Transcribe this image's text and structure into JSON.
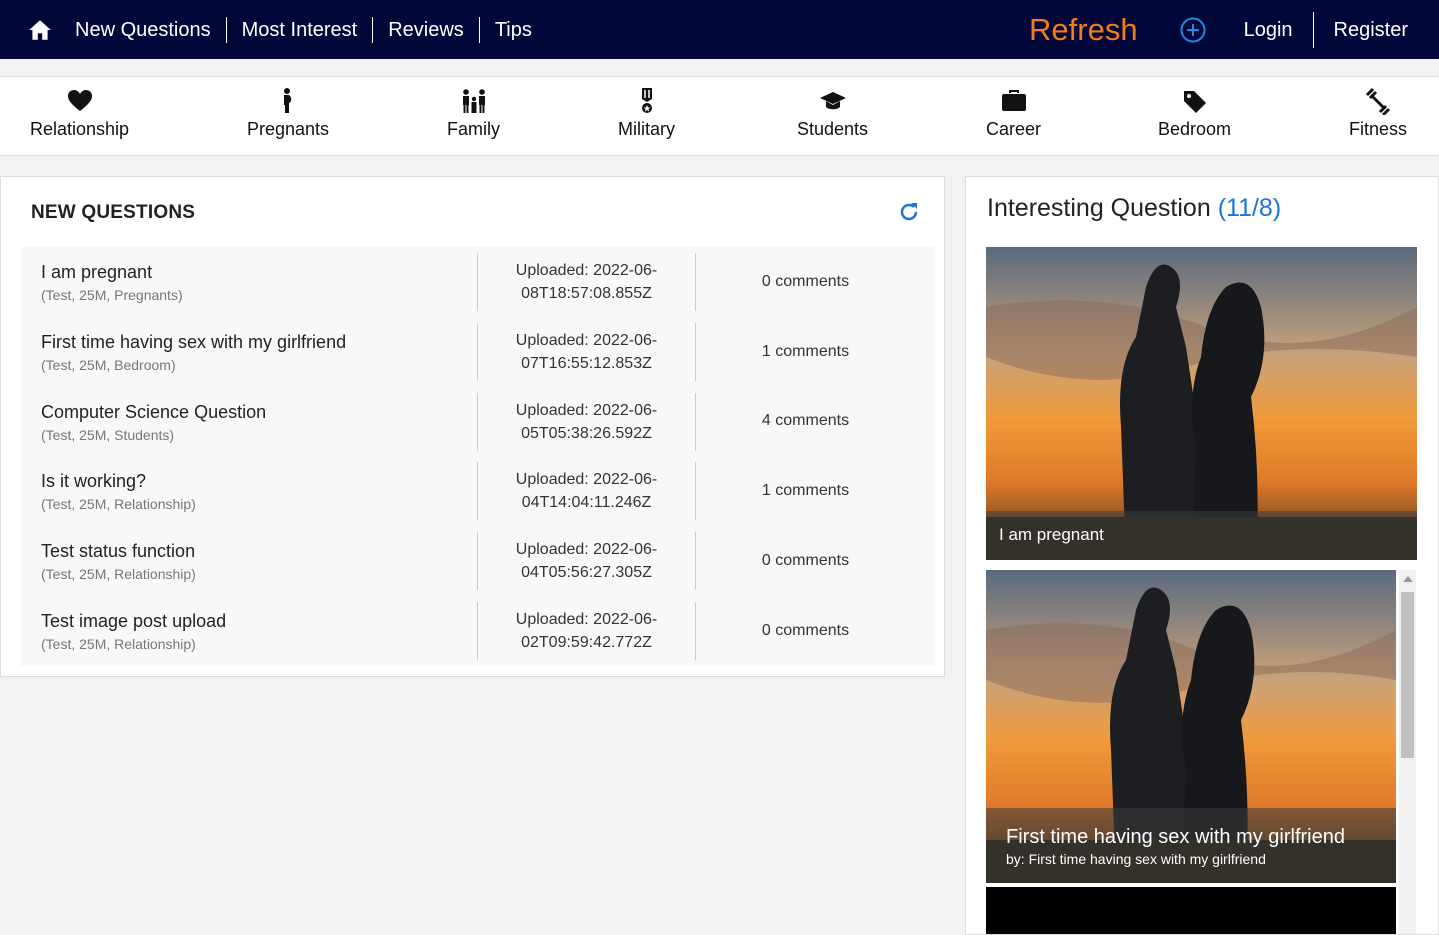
{
  "nav": {
    "links": [
      "New Questions",
      "Most Interest",
      "Reviews",
      "Tips"
    ],
    "refresh": "Refresh",
    "login": "Login",
    "register": "Register"
  },
  "categories": [
    {
      "label": "Relationship",
      "icon": "heart-icon"
    },
    {
      "label": "Pregnants",
      "icon": "pregnant-icon"
    },
    {
      "label": "Family",
      "icon": "family-icon"
    },
    {
      "label": "Military",
      "icon": "medal-icon"
    },
    {
      "label": "Students",
      "icon": "graduation-cap-icon"
    },
    {
      "label": "Career",
      "icon": "briefcase-icon"
    },
    {
      "label": "Bedroom",
      "icon": "tag-icon"
    },
    {
      "label": "Fitness",
      "icon": "dumbbell-icon"
    }
  ],
  "new_questions": {
    "title": "NEW QUESTIONS",
    "rows": [
      {
        "title": "I am pregnant",
        "meta": "(Test, 25M, Pregnants)",
        "uploaded": "Uploaded: 2022-06-08T18:57:08.855Z",
        "comments": "0 comments"
      },
      {
        "title": "First time having sex with my girlfriend",
        "meta": "(Test, 25M, Bedroom)",
        "uploaded": "Uploaded: 2022-06-07T16:55:12.853Z",
        "comments": "1 comments"
      },
      {
        "title": "Computer Science Question",
        "meta": "(Test, 25M, Students)",
        "uploaded": "Uploaded: 2022-06-05T05:38:26.592Z",
        "comments": "4 comments"
      },
      {
        "title": "Is it working?",
        "meta": "(Test, 25M, Relationship)",
        "uploaded": "Uploaded: 2022-06-04T14:04:11.246Z",
        "comments": "1 comments"
      },
      {
        "title": "Test status function",
        "meta": "(Test, 25M, Relationship)",
        "uploaded": "Uploaded: 2022-06-04T05:56:27.305Z",
        "comments": "0 comments"
      },
      {
        "title": "Test image post upload",
        "meta": "(Test, 25M, Relationship)",
        "uploaded": "Uploaded: 2022-06-02T09:59:42.772Z",
        "comments": "0 comments"
      }
    ]
  },
  "interesting": {
    "title": "Interesting Question",
    "count": "(11/8)",
    "cards": [
      {
        "caption": "I am pregnant"
      },
      {
        "caption": "First time having sex with my girlfriend",
        "by": "by: First time having sex with my girlfriend"
      }
    ]
  },
  "colors": {
    "nav_bg": "#02073a",
    "refresh": "#f07c1c",
    "accent": "#1976d2"
  }
}
